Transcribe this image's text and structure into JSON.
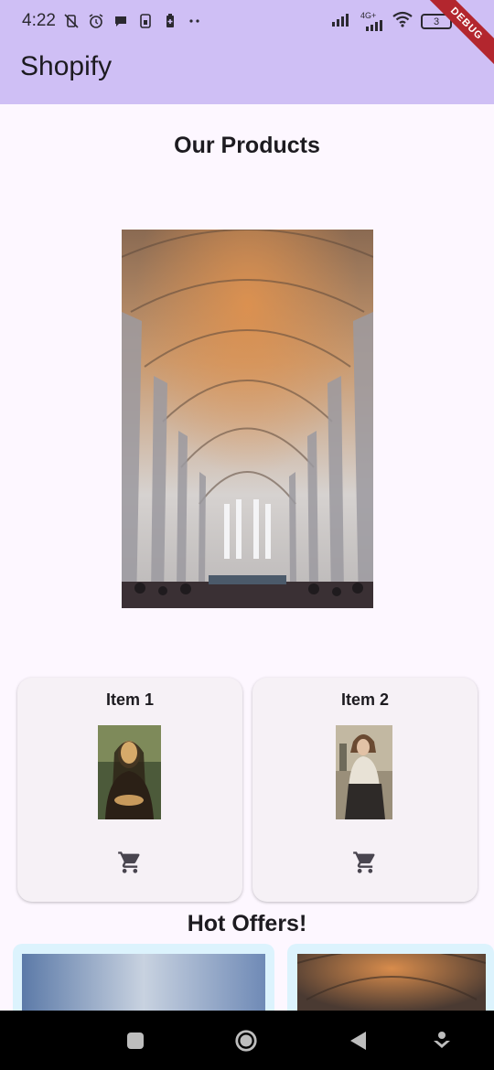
{
  "status_bar": {
    "time": "4:22",
    "network_label": "4G+",
    "battery": "3",
    "icons_left": [
      "vibrate-off-icon",
      "alarm-icon",
      "chat-icon",
      "sim-icon",
      "battery-saver-icon",
      "more-dots-icon"
    ],
    "icons_right": [
      "signal-icon",
      "signal-4g-icon",
      "wifi-icon",
      "battery-icon"
    ]
  },
  "debug_banner": "DEBUG",
  "app_bar": {
    "title": "Shopify"
  },
  "products": {
    "title": "Our Products"
  },
  "items": [
    {
      "name": "Item 1",
      "image": "mona-lisa-painting",
      "action_icon": "cart-icon"
    },
    {
      "name": "Item 2",
      "image": "girl-portrait-painting",
      "action_icon": "cart-icon"
    }
  ],
  "offers": {
    "title": "Hot Offers!"
  },
  "colors": {
    "app_bar": "#cfbff5",
    "background": "#fdf7ff",
    "card": "#f6f1f6",
    "offer_card": "#dcf3fd",
    "nav_bar": "#000000",
    "debug": "#b3262e"
  },
  "nav": [
    "recents-button",
    "home-button",
    "back-button",
    "assistant-button"
  ]
}
